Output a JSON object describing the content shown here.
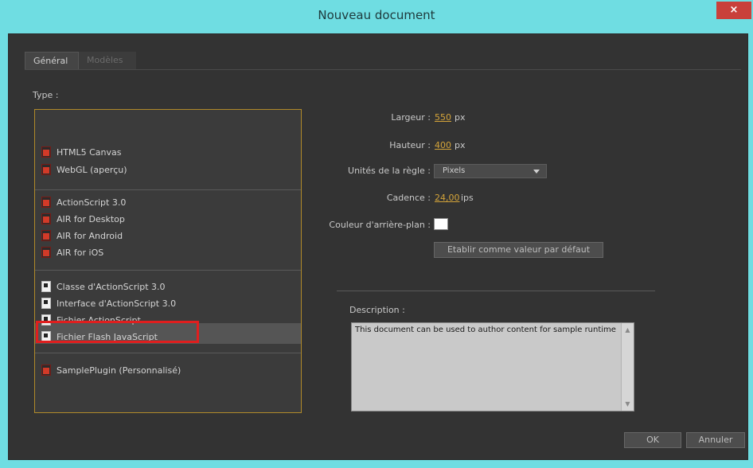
{
  "window": {
    "title": "Nouveau document",
    "close_label": "×"
  },
  "tabs": [
    {
      "label": "Général",
      "active": true
    },
    {
      "label": "Modèles",
      "active": false
    }
  ],
  "type_section": {
    "label": "Type :",
    "items": [
      {
        "label": "HTML5 Canvas",
        "icon": "red-document-icon"
      },
      {
        "label": "WebGL (aperçu)",
        "icon": "red-document-icon"
      },
      {
        "label": "ActionScript 3.0",
        "icon": "red-document-icon"
      },
      {
        "label": "AIR for Desktop",
        "icon": "red-document-icon"
      },
      {
        "label": "AIR for Android",
        "icon": "red-document-icon"
      },
      {
        "label": "AIR for iOS",
        "icon": "red-document-icon"
      },
      {
        "label": "Classe d'ActionScript 3.0",
        "icon": "white-document-icon"
      },
      {
        "label": "Interface d'ActionScript 3.0",
        "icon": "white-document-icon"
      },
      {
        "label": "Fichier ActionScript",
        "icon": "white-document-icon"
      },
      {
        "label": "Fichier Flash JavaScript",
        "icon": "white-document-icon"
      },
      {
        "label": "SamplePlugin (Personnalisé)",
        "icon": "red-document-icon",
        "selected": true
      }
    ]
  },
  "properties": {
    "width_label": "Largeur :",
    "width_value": "550",
    "width_unit": "px",
    "height_label": "Hauteur :",
    "height_value": "400",
    "height_unit": "px",
    "ruler_label": "Unités de la règle :",
    "ruler_value": "Pixels",
    "framerate_label": "Cadence :",
    "framerate_value": "24,00",
    "framerate_unit": "ips",
    "bgcolor_label": "Couleur d'arrière-plan :",
    "bgcolor_value": "#FFFFFF",
    "default_button": "Etablir comme valeur par défaut"
  },
  "description": {
    "label": "Description :",
    "text": "This document can be used to author content for sample runtime"
  },
  "buttons": {
    "ok": "OK",
    "cancel": "Annuler"
  },
  "colors": {
    "accent": "#d4a43a",
    "title_bar": "#6fdde2",
    "highlight": "#e01e1e"
  }
}
